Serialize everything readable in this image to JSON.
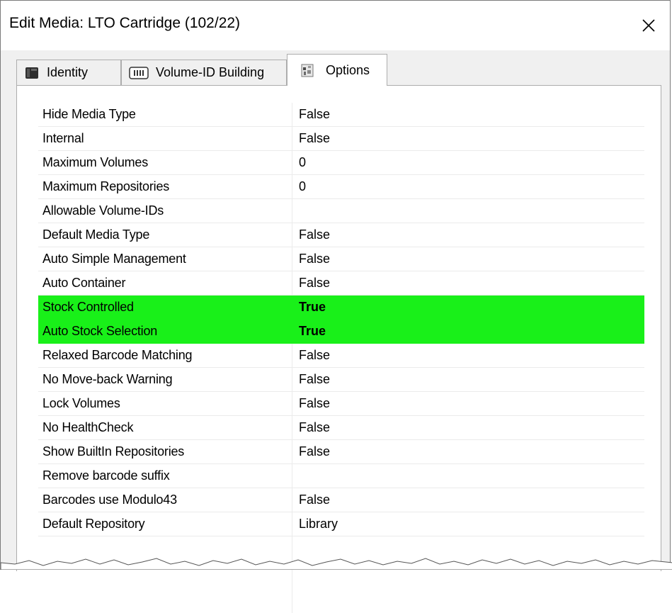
{
  "window": {
    "title": "Edit Media: LTO Cartridge (102/22)",
    "close_label": "×"
  },
  "tabs": [
    {
      "label": "Identity",
      "icon": "cartridge-icon",
      "active": false
    },
    {
      "label": "Volume-ID Building",
      "icon": "barcode-icon",
      "active": false
    },
    {
      "label": "Options",
      "icon": "options-icon",
      "active": true
    }
  ],
  "options": [
    {
      "name": "Hide Media Type",
      "value": "False",
      "highlight": false
    },
    {
      "name": "Internal",
      "value": "False",
      "highlight": false
    },
    {
      "name": "Maximum Volumes",
      "value": "0",
      "highlight": false
    },
    {
      "name": "Maximum Repositories",
      "value": "0",
      "highlight": false
    },
    {
      "name": "Allowable Volume-IDs",
      "value": "",
      "highlight": false
    },
    {
      "name": "Default Media Type",
      "value": "False",
      "highlight": false
    },
    {
      "name": "Auto Simple Management",
      "value": "False",
      "highlight": false
    },
    {
      "name": "Auto Container",
      "value": "False",
      "highlight": false
    },
    {
      "name": "Stock Controlled",
      "value": "True",
      "highlight": true
    },
    {
      "name": "Auto Stock Selection",
      "value": "True",
      "highlight": true
    },
    {
      "name": "Relaxed Barcode Matching",
      "value": "False",
      "highlight": false
    },
    {
      "name": "No Move-back Warning",
      "value": "False",
      "highlight": false
    },
    {
      "name": "Lock Volumes",
      "value": "False",
      "highlight": false
    },
    {
      "name": "No HealthCheck",
      "value": "False",
      "highlight": false
    },
    {
      "name": "Show BuiltIn Repositories",
      "value": "False",
      "highlight": false
    },
    {
      "name": "Remove barcode suffix",
      "value": "",
      "highlight": false
    },
    {
      "name": "Barcodes use Modulo43",
      "value": "False",
      "highlight": false
    },
    {
      "name": "Default Repository",
      "value": "Library",
      "highlight": false
    }
  ],
  "colors": {
    "highlight": "#19f019",
    "dialog_bg": "#f0f0f0",
    "panel_bg": "#ffffff"
  }
}
